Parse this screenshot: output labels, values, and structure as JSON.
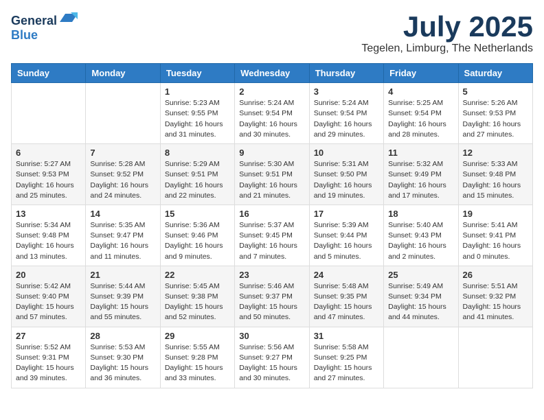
{
  "logo": {
    "general": "General",
    "blue": "Blue"
  },
  "header": {
    "month": "July 2025",
    "location": "Tegelen, Limburg, The Netherlands"
  },
  "weekdays": [
    "Sunday",
    "Monday",
    "Tuesday",
    "Wednesday",
    "Thursday",
    "Friday",
    "Saturday"
  ],
  "weeks": [
    [
      {
        "day": "",
        "info": ""
      },
      {
        "day": "",
        "info": ""
      },
      {
        "day": "1",
        "info": "Sunrise: 5:23 AM\nSunset: 9:55 PM\nDaylight: 16 hours\nand 31 minutes."
      },
      {
        "day": "2",
        "info": "Sunrise: 5:24 AM\nSunset: 9:54 PM\nDaylight: 16 hours\nand 30 minutes."
      },
      {
        "day": "3",
        "info": "Sunrise: 5:24 AM\nSunset: 9:54 PM\nDaylight: 16 hours\nand 29 minutes."
      },
      {
        "day": "4",
        "info": "Sunrise: 5:25 AM\nSunset: 9:54 PM\nDaylight: 16 hours\nand 28 minutes."
      },
      {
        "day": "5",
        "info": "Sunrise: 5:26 AM\nSunset: 9:53 PM\nDaylight: 16 hours\nand 27 minutes."
      }
    ],
    [
      {
        "day": "6",
        "info": "Sunrise: 5:27 AM\nSunset: 9:53 PM\nDaylight: 16 hours\nand 25 minutes."
      },
      {
        "day": "7",
        "info": "Sunrise: 5:28 AM\nSunset: 9:52 PM\nDaylight: 16 hours\nand 24 minutes."
      },
      {
        "day": "8",
        "info": "Sunrise: 5:29 AM\nSunset: 9:51 PM\nDaylight: 16 hours\nand 22 minutes."
      },
      {
        "day": "9",
        "info": "Sunrise: 5:30 AM\nSunset: 9:51 PM\nDaylight: 16 hours\nand 21 minutes."
      },
      {
        "day": "10",
        "info": "Sunrise: 5:31 AM\nSunset: 9:50 PM\nDaylight: 16 hours\nand 19 minutes."
      },
      {
        "day": "11",
        "info": "Sunrise: 5:32 AM\nSunset: 9:49 PM\nDaylight: 16 hours\nand 17 minutes."
      },
      {
        "day": "12",
        "info": "Sunrise: 5:33 AM\nSunset: 9:48 PM\nDaylight: 16 hours\nand 15 minutes."
      }
    ],
    [
      {
        "day": "13",
        "info": "Sunrise: 5:34 AM\nSunset: 9:48 PM\nDaylight: 16 hours\nand 13 minutes."
      },
      {
        "day": "14",
        "info": "Sunrise: 5:35 AM\nSunset: 9:47 PM\nDaylight: 16 hours\nand 11 minutes."
      },
      {
        "day": "15",
        "info": "Sunrise: 5:36 AM\nSunset: 9:46 PM\nDaylight: 16 hours\nand 9 minutes."
      },
      {
        "day": "16",
        "info": "Sunrise: 5:37 AM\nSunset: 9:45 PM\nDaylight: 16 hours\nand 7 minutes."
      },
      {
        "day": "17",
        "info": "Sunrise: 5:39 AM\nSunset: 9:44 PM\nDaylight: 16 hours\nand 5 minutes."
      },
      {
        "day": "18",
        "info": "Sunrise: 5:40 AM\nSunset: 9:43 PM\nDaylight: 16 hours\nand 2 minutes."
      },
      {
        "day": "19",
        "info": "Sunrise: 5:41 AM\nSunset: 9:41 PM\nDaylight: 16 hours\nand 0 minutes."
      }
    ],
    [
      {
        "day": "20",
        "info": "Sunrise: 5:42 AM\nSunset: 9:40 PM\nDaylight: 15 hours\nand 57 minutes."
      },
      {
        "day": "21",
        "info": "Sunrise: 5:44 AM\nSunset: 9:39 PM\nDaylight: 15 hours\nand 55 minutes."
      },
      {
        "day": "22",
        "info": "Sunrise: 5:45 AM\nSunset: 9:38 PM\nDaylight: 15 hours\nand 52 minutes."
      },
      {
        "day": "23",
        "info": "Sunrise: 5:46 AM\nSunset: 9:37 PM\nDaylight: 15 hours\nand 50 minutes."
      },
      {
        "day": "24",
        "info": "Sunrise: 5:48 AM\nSunset: 9:35 PM\nDaylight: 15 hours\nand 47 minutes."
      },
      {
        "day": "25",
        "info": "Sunrise: 5:49 AM\nSunset: 9:34 PM\nDaylight: 15 hours\nand 44 minutes."
      },
      {
        "day": "26",
        "info": "Sunrise: 5:51 AM\nSunset: 9:32 PM\nDaylight: 15 hours\nand 41 minutes."
      }
    ],
    [
      {
        "day": "27",
        "info": "Sunrise: 5:52 AM\nSunset: 9:31 PM\nDaylight: 15 hours\nand 39 minutes."
      },
      {
        "day": "28",
        "info": "Sunrise: 5:53 AM\nSunset: 9:30 PM\nDaylight: 15 hours\nand 36 minutes."
      },
      {
        "day": "29",
        "info": "Sunrise: 5:55 AM\nSunset: 9:28 PM\nDaylight: 15 hours\nand 33 minutes."
      },
      {
        "day": "30",
        "info": "Sunrise: 5:56 AM\nSunset: 9:27 PM\nDaylight: 15 hours\nand 30 minutes."
      },
      {
        "day": "31",
        "info": "Sunrise: 5:58 AM\nSunset: 9:25 PM\nDaylight: 15 hours\nand 27 minutes."
      },
      {
        "day": "",
        "info": ""
      },
      {
        "day": "",
        "info": ""
      }
    ]
  ]
}
